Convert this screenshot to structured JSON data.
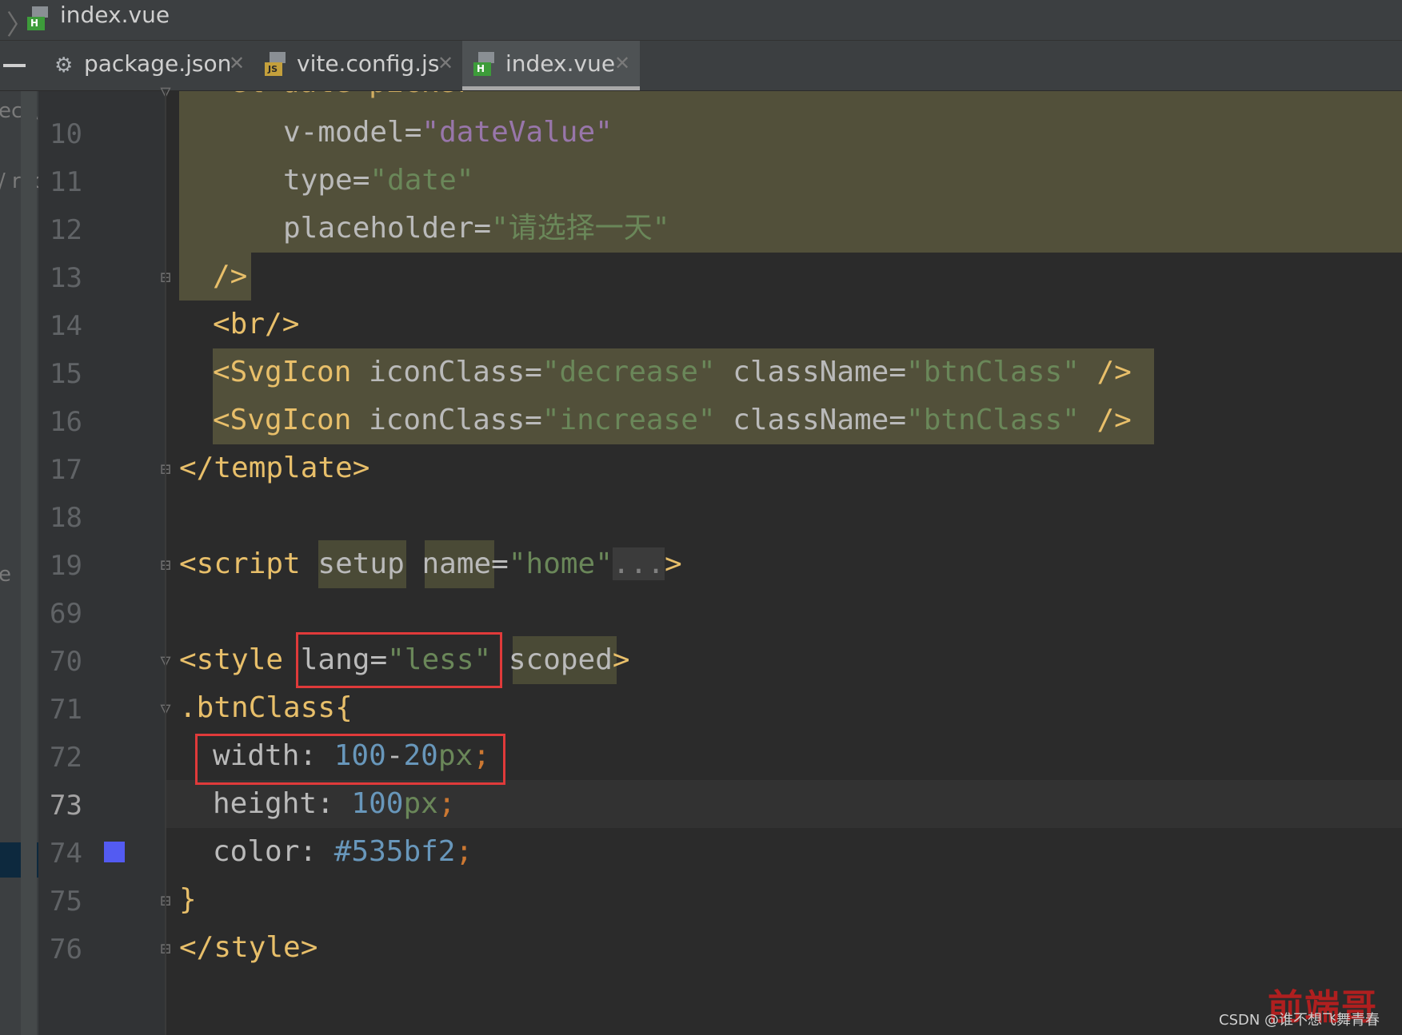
{
  "breadcrumb": {
    "file": "index.vue"
  },
  "tabs": [
    {
      "label": "package.json",
      "icon": "json-file-icon",
      "active": false
    },
    {
      "label": "vite.config.js",
      "icon": "js-file-icon",
      "active": false
    },
    {
      "label": "index.vue",
      "icon": "vue-file-icon",
      "active": true
    }
  ],
  "side_fragments": [
    "ect\\",
    "/ roo",
    "e"
  ],
  "line_numbers": [
    "10",
    "11",
    "12",
    "13",
    "14",
    "15",
    "16",
    "17",
    "18",
    "19",
    "69",
    "70",
    "71",
    "72",
    "73",
    "74",
    "75",
    "76"
  ],
  "current_line": "73",
  "partial_top": "<el-date-picker",
  "code": {
    "l10": {
      "attr": "v-model",
      "eq": "=",
      "val": "\"dateValue\""
    },
    "l11": {
      "attr": "type",
      "eq": "=",
      "val": "\"date\""
    },
    "l12": {
      "attr": "placeholder",
      "eq": "=",
      "val": "\"请选择一天\""
    },
    "l13": {
      "close": "/>"
    },
    "l14": {
      "tag": "<br/>"
    },
    "l15": {
      "open": "<SvgIcon",
      "a1": "iconClass",
      "v1": "\"decrease\"",
      "a2": "className",
      "v2": "\"btnClass\"",
      "close": "/>"
    },
    "l16": {
      "open": "<SvgIcon",
      "a1": "iconClass",
      "v1": "\"increase\"",
      "a2": "className",
      "v2": "\"btnClass\"",
      "close": "/>"
    },
    "l17": {
      "tag": "</template>"
    },
    "l19": {
      "open": "<script",
      "a1": "setup",
      "a2": "name",
      "v2": "\"home\"",
      "dots": "...",
      "close": ">"
    },
    "l70": {
      "open": "<style",
      "a1": "lang",
      "v1": "\"less\"",
      "a2": "scoped",
      "close": ">"
    },
    "l71": {
      "selector": ".btnClass",
      "brace": "{"
    },
    "l72": {
      "prop": "width",
      "colon": ":",
      "n1": "100",
      "minus": "-",
      "n2": "20",
      "unit": "px",
      "semi": ";"
    },
    "l73": {
      "prop": "height",
      "colon": ":",
      "n1": "100",
      "unit": "px",
      "semi": ";"
    },
    "l74": {
      "prop": "color",
      "colon": ":",
      "hex": "#535bf2",
      "semi": ";"
    },
    "l75": {
      "brace": "}"
    },
    "l76": {
      "tag": "</style>"
    }
  },
  "colors": {
    "swatch": "#535bf2",
    "annotation_box": "#e03a3a"
  },
  "watermark": {
    "logo": "前端哥",
    "text": "CSDN @谁不想飞舞青春"
  }
}
